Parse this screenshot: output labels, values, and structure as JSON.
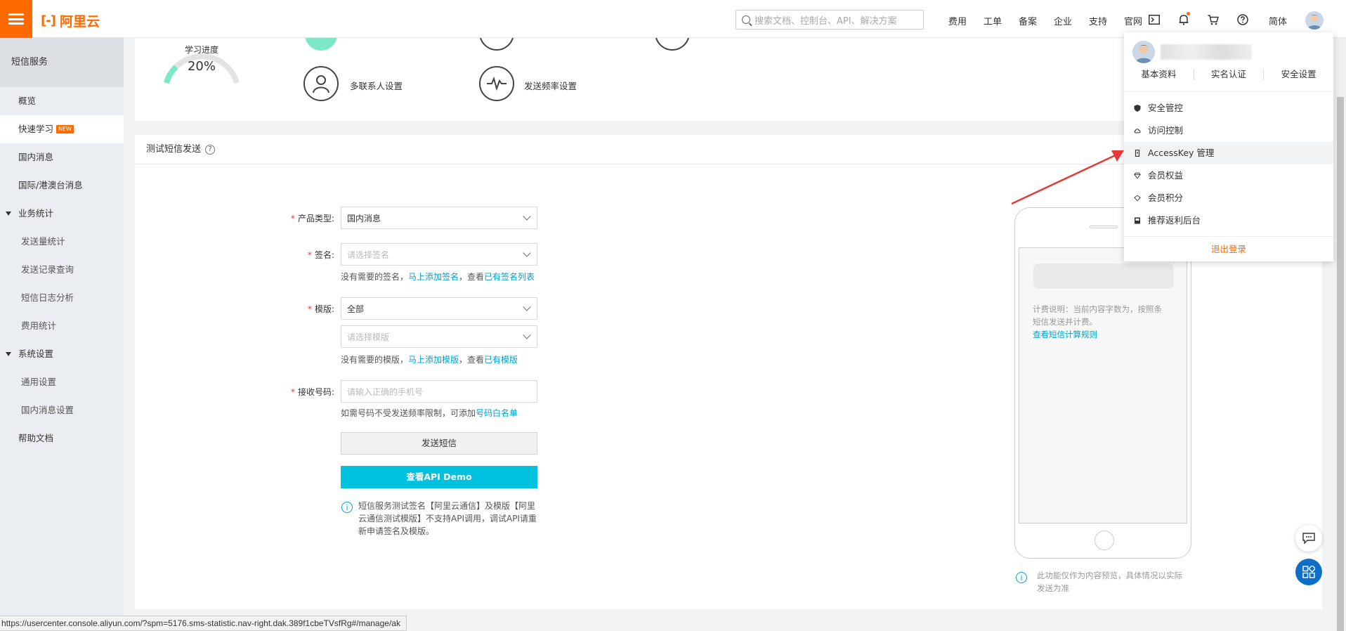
{
  "topbar": {
    "brand": "阿里云",
    "brand_mark": "[-]",
    "search_placeholder": "搜索文档、控制台、API、解决方案",
    "nav": [
      "费用",
      "工单",
      "备案",
      "企业",
      "支持",
      "官网"
    ],
    "lang": "简体"
  },
  "sidebar": {
    "header": "短信服务",
    "items": [
      {
        "label": "概览",
        "type": "item"
      },
      {
        "label": "快速学习",
        "type": "item",
        "badge": "NEW",
        "active": true
      },
      {
        "label": "国内消息",
        "type": "item"
      },
      {
        "label": "国际/港澳台消息",
        "type": "item"
      },
      {
        "label": "业务统计",
        "type": "group"
      },
      {
        "label": "发送量统计",
        "type": "sub"
      },
      {
        "label": "发送记录查询",
        "type": "sub"
      },
      {
        "label": "短信日志分析",
        "type": "sub"
      },
      {
        "label": "费用统计",
        "type": "sub"
      },
      {
        "label": "系统设置",
        "type": "group"
      },
      {
        "label": "通用设置",
        "type": "sub"
      },
      {
        "label": "国内消息设置",
        "type": "sub"
      },
      {
        "label": "帮助文档",
        "type": "item"
      }
    ]
  },
  "learning": {
    "label": "学习进度",
    "percent_text": "20%",
    "progress": 0.2,
    "features": [
      "多联系人设置",
      "发送频率设置"
    ]
  },
  "test_sms": {
    "title": "测试短信发送",
    "product_label": "产品类型:",
    "product_value": "国内消息",
    "sign_label": "签名:",
    "sign_placeholder": "请选择签名",
    "sign_hint_prefix": "没有需要的签名，",
    "sign_hint_link1": "马上添加签名",
    "sign_hint_mid": "，查看",
    "sign_hint_link2": "已有签名列表",
    "template_label": "模版:",
    "template_value": "全部",
    "template_placeholder": "请选择模版",
    "template_hint_prefix": "没有需要的模版，",
    "template_hint_link1": "马上添加模版",
    "template_hint_mid": "，查看",
    "template_hint_link2": "已有模版",
    "phone_label": "接收号码:",
    "phone_placeholder": "请输入正确的手机号",
    "phone_hint_prefix": "如需号码不受发送频率限制，可添加",
    "phone_hint_link": "号码白名单",
    "send_button": "发送短信",
    "api_button": "查看API Demo",
    "notice_line1": "短信服务测试签名【阿里云通信】及模版【阿里",
    "notice_line2": "云通信测试模版】不支持API调用，调试API请重",
    "notice_line3": "新申请签名及模版。"
  },
  "phone_preview": {
    "billing_line1": "计费说明：当前内容字数为，按照条",
    "billing_line2": "短信发送并计费。",
    "billing_link": "查看短信计算规则",
    "note_line1": "此功能仅作为内容预览，具体情况以实际",
    "note_line2": "发送为准"
  },
  "user_menu": {
    "links": [
      "基本资料",
      "实名认证",
      "安全设置"
    ],
    "items": [
      {
        "label": "安全管控",
        "icon": "shield-icon"
      },
      {
        "label": "访问控制",
        "icon": "cloud-icon"
      },
      {
        "label": "AccessKey 管理",
        "icon": "key-icon",
        "highlighted": true
      },
      {
        "label": "会员权益",
        "icon": "diamond-icon"
      },
      {
        "label": "会员积分",
        "icon": "diamond-outline-icon"
      },
      {
        "label": "推荐返利后台",
        "icon": "book-icon"
      }
    ],
    "logout": "退出登录"
  },
  "status_url": "https://usercenter.console.aliyun.com/?spm=5176.sms-statistic.nav-right.dak.389f1cbeTVsfRg#/manage/ak",
  "colors": {
    "accent": "#ff6a00",
    "link": "#00a2ca",
    "api_button": "#00c1de",
    "annotation_arrow": "#e53935"
  }
}
